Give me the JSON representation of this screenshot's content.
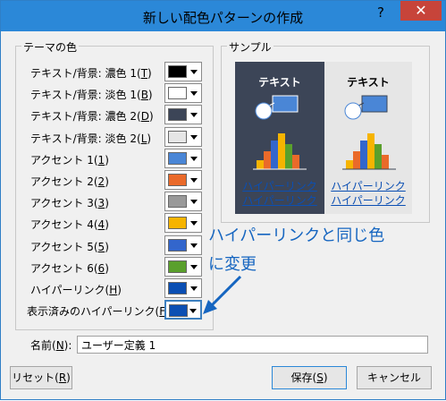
{
  "window": {
    "title": "新しい配色パターンの作成",
    "help": "?",
    "close": "✕"
  },
  "theme_colors": {
    "title": "テーマの色",
    "rows": [
      {
        "label": "テキスト/背景: 濃色 1(",
        "key": "T",
        "suffix": ")",
        "color": "#000000"
      },
      {
        "label": "テキスト/背景: 淡色 1(",
        "key": "B",
        "suffix": ")",
        "color": "#ffffff"
      },
      {
        "label": "テキスト/背景: 濃色 2(",
        "key": "D",
        "suffix": ")",
        "color": "#3c4557"
      },
      {
        "label": "テキスト/背景: 淡色 2(",
        "key": "L",
        "suffix": ")",
        "color": "#e6e6e6"
      },
      {
        "label": "アクセント 1(",
        "key": "1",
        "suffix": ")",
        "color": "#4a86d6"
      },
      {
        "label": "アクセント 2(",
        "key": "2",
        "suffix": ")",
        "color": "#ea6a2a"
      },
      {
        "label": "アクセント 3(",
        "key": "3",
        "suffix": ")",
        "color": "#999999"
      },
      {
        "label": "アクセント 4(",
        "key": "4",
        "suffix": ")",
        "color": "#f6b400"
      },
      {
        "label": "アクセント 5(",
        "key": "5",
        "suffix": ")",
        "color": "#3366cc"
      },
      {
        "label": "アクセント 6(",
        "key": "6",
        "suffix": ")",
        "color": "#5aa02c"
      },
      {
        "label": "ハイパーリンク(",
        "key": "H",
        "suffix": ")",
        "color": "#0b4fb3"
      },
      {
        "label": "表示済みのハイパーリンク(",
        "key": "F",
        "suffix": ")",
        "color": "#0b4fb3"
      }
    ]
  },
  "sample": {
    "title": "サンプル",
    "dark_text": "テキスト",
    "light_text": "テキスト",
    "link1": "ハイパーリンク",
    "link2": "ハイパーリンク"
  },
  "callout": {
    "line1": "ハイパーリンクと同じ色",
    "line2": "に変更"
  },
  "name_field": {
    "label": "名前(",
    "key": "N",
    "suffix": "):",
    "value": "ユーザー定義 1"
  },
  "buttons": {
    "reset": {
      "label": "リセット(",
      "key": "R",
      "suffix": ")"
    },
    "save": {
      "label": "保存(",
      "key": "S",
      "suffix": ")"
    },
    "cancel": "キャンセル"
  }
}
